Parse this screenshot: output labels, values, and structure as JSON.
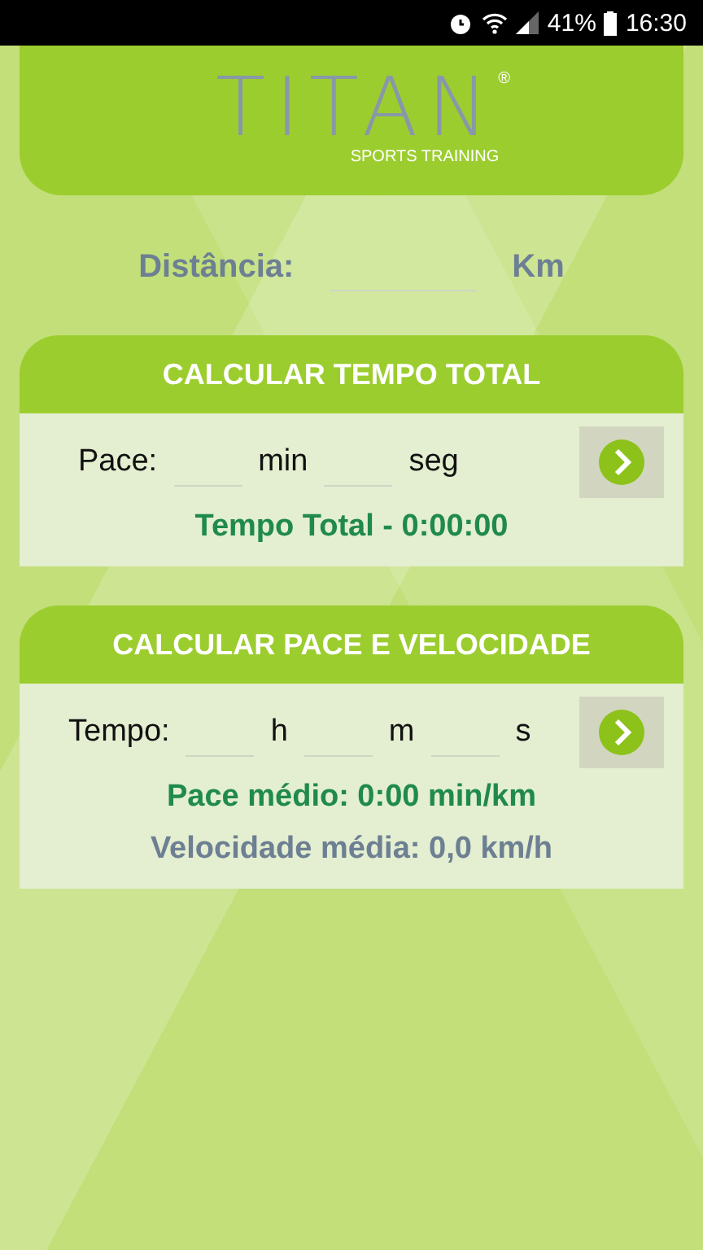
{
  "status_bar": {
    "battery": "41%",
    "time": "16:30"
  },
  "logo": {
    "title": "TITAN",
    "registered": "®",
    "tagline": "SPORTS TRAINING"
  },
  "distance": {
    "label": "Distância:",
    "unit": "Km"
  },
  "cards": [
    {
      "title": "CALCULAR TEMPO TOTAL",
      "label": "Pace:",
      "fields": [
        {
          "unit": "min"
        },
        {
          "unit": "seg"
        }
      ],
      "results": [
        {
          "text": "Tempo Total - 0:00:00",
          "kind": "primary"
        }
      ]
    },
    {
      "title": "CALCULAR PACE E VELOCIDADE",
      "label": "Tempo:",
      "fields": [
        {
          "unit": "h"
        },
        {
          "unit": "m"
        },
        {
          "unit": "s"
        }
      ],
      "results": [
        {
          "text": "Pace médio: 0:00 min/km",
          "kind": "primary"
        },
        {
          "text": "Velocidade média: 0,0 km/h",
          "kind": "secondary"
        }
      ]
    }
  ]
}
